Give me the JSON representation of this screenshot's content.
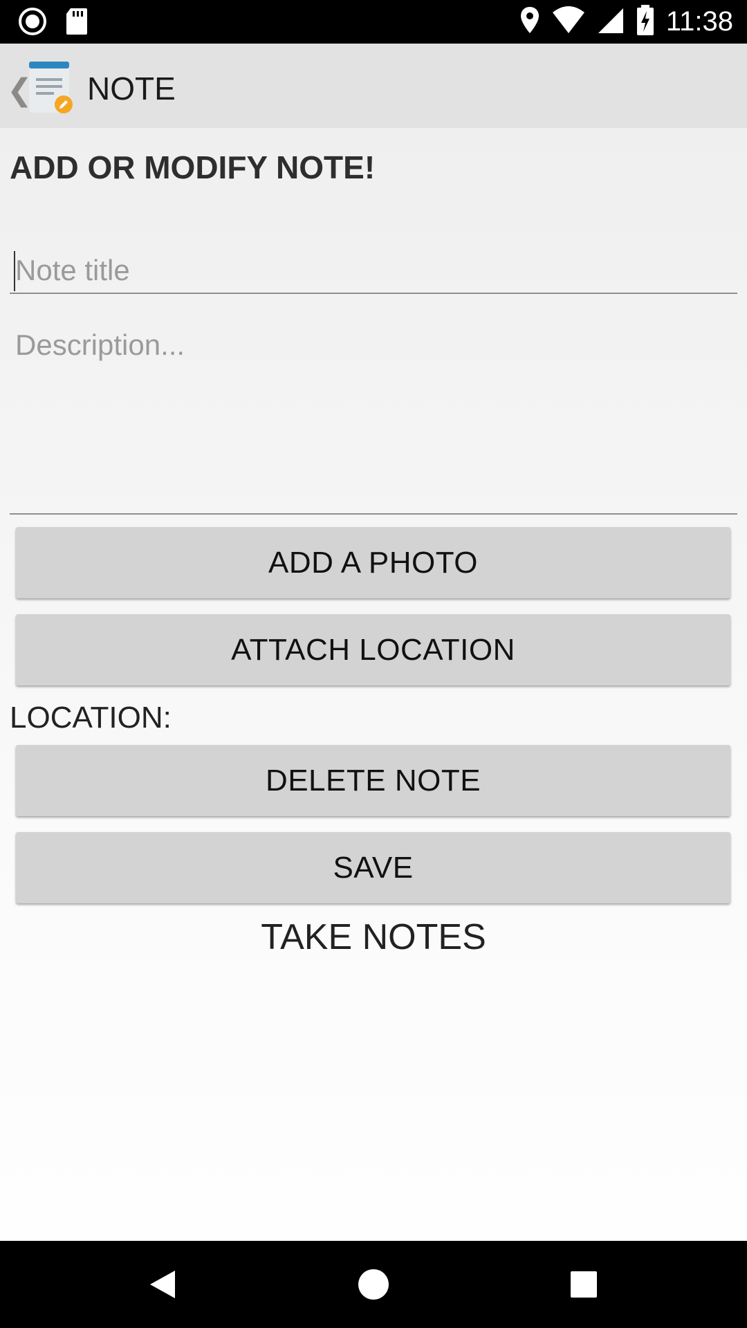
{
  "status_bar": {
    "time": "11:38",
    "icons": [
      "record-icon",
      "sd-card-icon",
      "location-pin-icon",
      "wifi-icon",
      "signal-icon",
      "battery-charging-icon"
    ]
  },
  "app_bar": {
    "title": "NOTE",
    "back_icon": "chevron-left-icon",
    "app_icon": "note-edit-icon"
  },
  "form": {
    "heading": "ADD OR MODIFY NOTE!",
    "title_placeholder": "Note title",
    "title_value": "",
    "description_placeholder": "Description...",
    "description_value": "",
    "add_photo_label": "ADD A PHOTO",
    "attach_location_label": "ATTACH LOCATION",
    "location_label": "LOCATION:",
    "delete_label": "DELETE NOTE",
    "save_label": "SAVE",
    "footer_text": "TAKE NOTES"
  },
  "nav_bar": {
    "icons": [
      "back-triangle-icon",
      "home-circle-icon",
      "recents-square-icon"
    ]
  },
  "colors": {
    "status_bar": "#000000",
    "app_bar": "#e2e2e2",
    "button": "#d3d3d3",
    "accent_orange": "#f5a623",
    "icon_blue": "#2e86c1"
  }
}
